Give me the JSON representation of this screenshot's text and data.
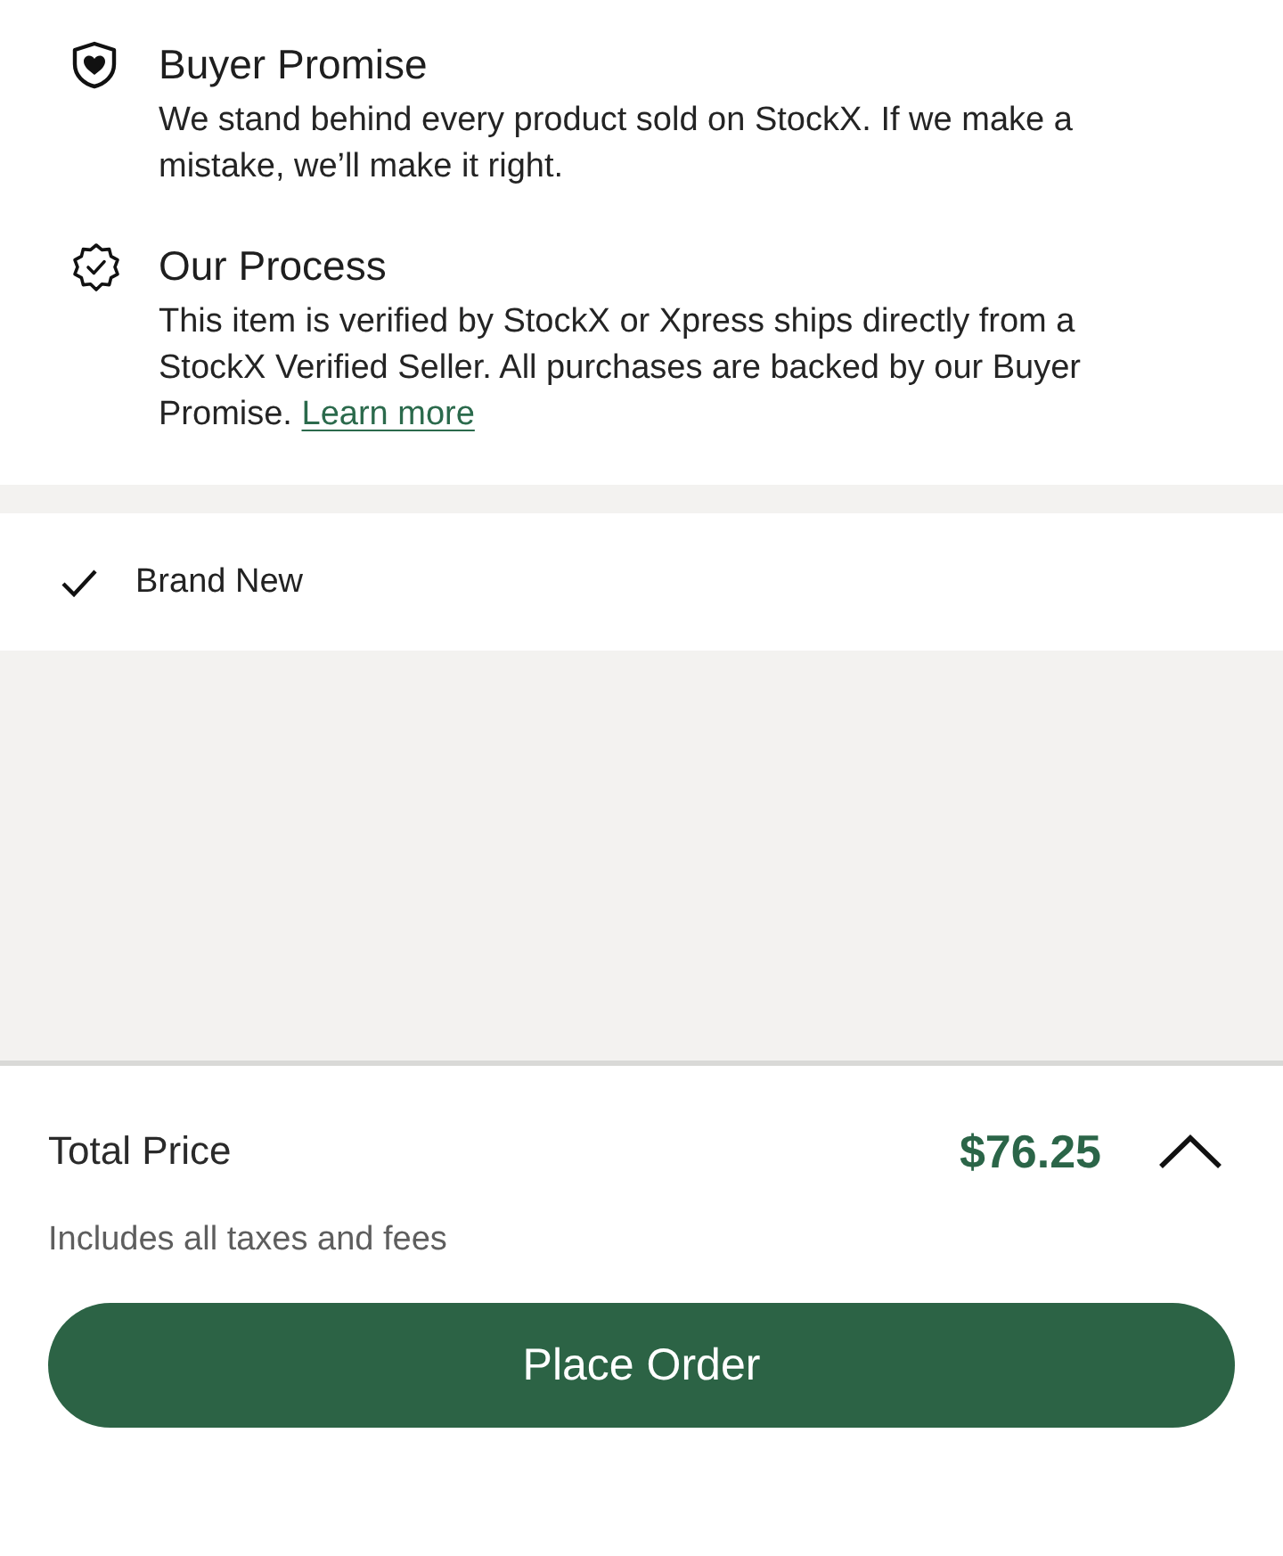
{
  "features": [
    {
      "kind": "shield",
      "title": "Buyer Promise",
      "text": "We stand behind every product sold on StockX. If we make a mistake, we’ll make it right."
    },
    {
      "kind": "badge",
      "title": "Our Process",
      "text": "This item is verified by StockX or Xpress ships directly from a StockX Verified Seller. All purchases are backed by our Buyer Promise.",
      "link": "Learn more"
    }
  ],
  "condition": {
    "label": "Brand New"
  },
  "summary": {
    "label": "Total Price",
    "price": "$76.25",
    "note": "Includes all taxes and fees"
  },
  "button": {
    "label": "Place Order"
  }
}
